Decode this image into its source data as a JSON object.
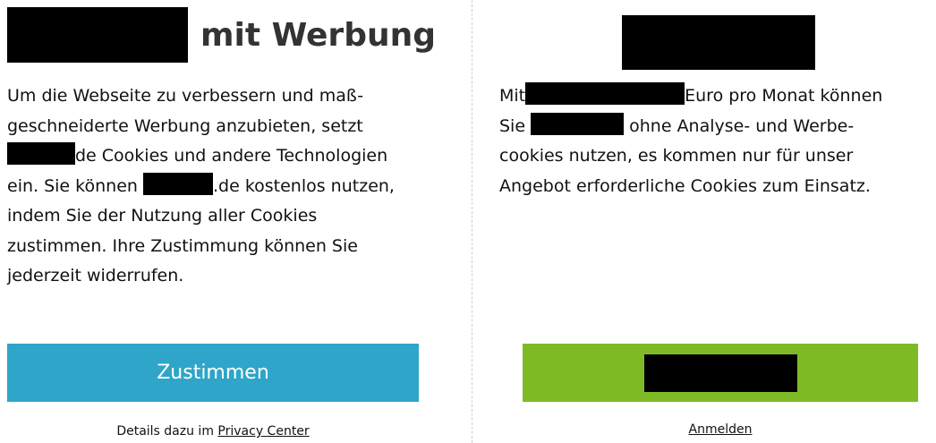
{
  "left": {
    "title": "mit Werbung",
    "body_lines": [
      "Um die Webseite zu verbessern und maß-",
      "geschneiderte Werbung anzubieten, setzt",
      "de Cookies und andere Technologien",
      "ein. Sie können",
      ".de kostenlos nutzen,",
      "indem Sie der Nutzung aller Cookies",
      "zustimmen. Ihre Zustimmung können Sie",
      "jederzeit widerrufen."
    ],
    "agree_button": "Zustimmen",
    "details_prefix": "Details dazu im",
    "privacy_link": "Privacy Center"
  },
  "right": {
    "body_lines": [
      "Mit",
      "Euro pro Monat können",
      "Sie",
      "ohne Analyse- und Werbe-",
      "cookies nutzen, es kommen nur für unser",
      "Angebot erforderliche Cookies zum Einsatz."
    ],
    "login_link": "Anmelden"
  },
  "colors": {
    "agree_button": "#2ea5c9",
    "subscribe_button": "#7eba26",
    "redaction": "#000000"
  }
}
